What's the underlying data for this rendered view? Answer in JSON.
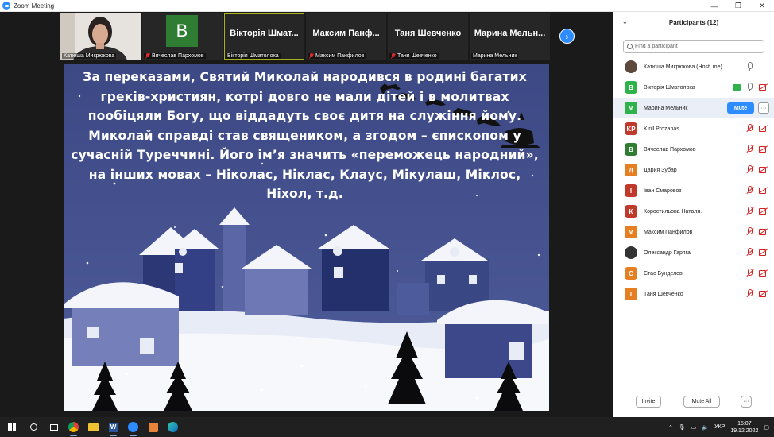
{
  "window": {
    "title": "Zoom Meeting"
  },
  "tiles": [
    {
      "name": "Катюша Микрюкова",
      "type": "video",
      "muted": false
    },
    {
      "name": "Вячеслав Пархомов",
      "type": "avatar",
      "initial": "B",
      "muted": true
    },
    {
      "name": "Вікторія Шматолоха",
      "big": "Вікторія Шмат...",
      "type": "name",
      "muted": false,
      "active": true
    },
    {
      "name": "Максим  Панфилов",
      "big": "Максим  Панф...",
      "type": "name",
      "muted": true
    },
    {
      "name": "Таня Шевченко",
      "big": "Таня Шевченко",
      "type": "name",
      "muted": true
    },
    {
      "name": "Марина Мельник",
      "big": "Марина  Мельн...",
      "type": "name",
      "muted": false
    }
  ],
  "slide": {
    "text": "За переказами, Святий Миколай народився в родині багатих греків-християн, котрі довго не мали дітей і в молитвах пообіцяли Богу, що віддадуть своє дитя на служіння йому. Миколай справді став священиком, а згодом – єпископом у сучасній Туреччині. Його ім’я значить «переможець народний», на інших мовах – Ніколас, Ніклас, Клаус, Мікулаш, Міклос, Ніхол, т.д."
  },
  "panel": {
    "title": "Participants (12)",
    "search_placeholder": "Find a participant",
    "mute_label": "Mute",
    "more_label": "···",
    "invite_label": "Invite",
    "mute_all_label": "Mute All",
    "footer_more_label": "···",
    "participants": [
      {
        "name": "Катюша Микрюкова (Host, me)",
        "initial": "",
        "color": "#5b4a3d",
        "photo": true,
        "mic": "on",
        "cam": "none"
      },
      {
        "name": "Вікторія Шматолоха",
        "initial": "В",
        "color": "#2fb24c",
        "mic": "on",
        "cam": "off",
        "share": true
      },
      {
        "name": "Марина Мельник",
        "initial": "М",
        "color": "#2fb24c",
        "mic": "hover",
        "cam": "none",
        "hover": true
      },
      {
        "name": "Kirill Prozapas",
        "initial": "KP",
        "color": "#c0392b",
        "mic": "off",
        "cam": "off"
      },
      {
        "name": "Вячеслав Пархомов",
        "initial": "В",
        "color": "#2e7d32",
        "mic": "off",
        "cam": "off"
      },
      {
        "name": "Дария Зубар",
        "initial": "Д",
        "color": "#e67e22",
        "mic": "off",
        "cam": "off"
      },
      {
        "name": "Іван Смаровоз",
        "initial": "І",
        "color": "#c0392b",
        "mic": "off",
        "cam": "off"
      },
      {
        "name": "Коростильова Наталя.",
        "initial": "К",
        "color": "#c0392b",
        "mic": "off",
        "cam": "off"
      },
      {
        "name": "Максим  Панфилов",
        "initial": "М",
        "color": "#e67e22",
        "mic": "off",
        "cam": "off"
      },
      {
        "name": "Олександр Гаряга",
        "initial": "",
        "color": "#333333",
        "photo": true,
        "mic": "off",
        "cam": "off"
      },
      {
        "name": "Стас Бунделев",
        "initial": "С",
        "color": "#e67e22",
        "mic": "off",
        "cam": "off"
      },
      {
        "name": "Таня Шевченко",
        "initial": "Т",
        "color": "#e67e22",
        "mic": "off",
        "cam": "off"
      }
    ]
  },
  "taskbar": {
    "lang": "УКР",
    "time": "15:07",
    "date": "19.12.2022",
    "apps": [
      "search-icon",
      "task-view-icon",
      "chrome-icon",
      "file-explorer-icon",
      "word-icon",
      "zoom-icon",
      "media-player-icon",
      "edge-icon"
    ]
  }
}
